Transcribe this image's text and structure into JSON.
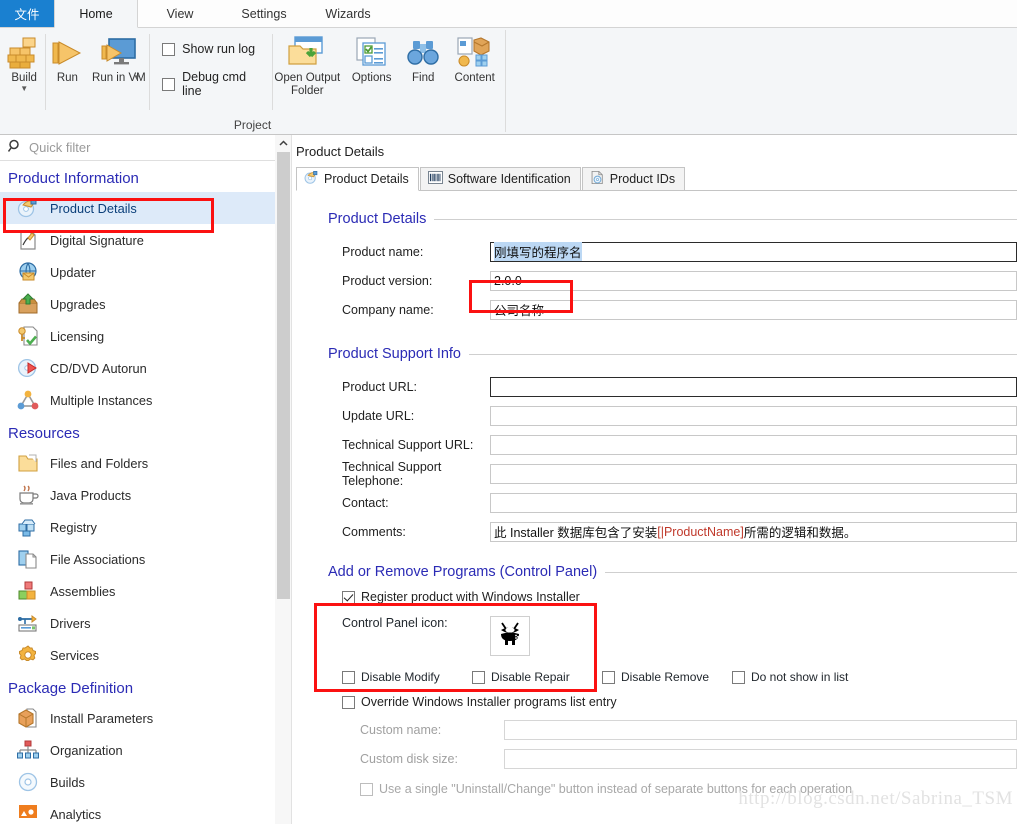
{
  "ribbon": {
    "tabs": [
      {
        "label": "文件",
        "id": "file"
      },
      {
        "label": "Home",
        "id": "home"
      },
      {
        "label": "View",
        "id": "view"
      },
      {
        "label": "Settings",
        "id": "settings"
      },
      {
        "label": "Wizards",
        "id": "wizards"
      }
    ],
    "buttons": {
      "build": "Build",
      "run": "Run",
      "run_in_vm": "Run in VM",
      "open_output_folder": "Open Output Folder",
      "options": "Options",
      "find": "Find",
      "content": "Content"
    },
    "checkboxes": [
      {
        "label": "Show run log",
        "checked": false
      },
      {
        "label": "Debug cmd line",
        "checked": false
      }
    ],
    "group_label": "Project"
  },
  "sidebar": {
    "filter_placeholder": "Quick filter",
    "sections": [
      {
        "title": "Product Information",
        "items": [
          {
            "label": "Product Details",
            "icon": "disc-hand-icon",
            "selected": true
          },
          {
            "label": "Digital Signature",
            "icon": "signature-page-icon",
            "selected": false
          },
          {
            "label": "Updater",
            "icon": "globe-mail-icon",
            "selected": false
          },
          {
            "label": "Upgrades",
            "icon": "box-up-arrow-icon",
            "selected": false
          },
          {
            "label": "Licensing",
            "icon": "key-check-icon",
            "selected": false
          },
          {
            "label": "CD/DVD Autorun",
            "icon": "disc-play-icon",
            "selected": false
          },
          {
            "label": "Multiple Instances",
            "icon": "nodes-icon",
            "selected": false
          }
        ]
      },
      {
        "title": "Resources",
        "items": [
          {
            "label": "Files and Folders",
            "icon": "folder-icon",
            "selected": false
          },
          {
            "label": "Java Products",
            "icon": "coffee-cup-icon",
            "selected": false
          },
          {
            "label": "Registry",
            "icon": "registry-blocks-icon",
            "selected": false
          },
          {
            "label": "File Associations",
            "icon": "file-pages-icon",
            "selected": false
          },
          {
            "label": "Assemblies",
            "icon": "cubes-icon",
            "selected": false
          },
          {
            "label": "Drivers",
            "icon": "usb-icon",
            "selected": false
          },
          {
            "label": "Services",
            "icon": "gear-icon",
            "selected": false
          }
        ]
      },
      {
        "title": "Package Definition",
        "items": [
          {
            "label": "Install Parameters",
            "icon": "open-box-icon",
            "selected": false
          },
          {
            "label": "Organization",
            "icon": "hierarchy-icon",
            "selected": false
          },
          {
            "label": "Builds",
            "icon": "disc-ring-icon",
            "selected": false
          },
          {
            "label": "Analytics",
            "icon": "chart-icon",
            "selected": false
          }
        ]
      }
    ]
  },
  "main": {
    "pane_title": "Product Details",
    "tabs": [
      {
        "label": "Product Details",
        "icon": "disc-hand-icon",
        "active": true
      },
      {
        "label": "Software Identification",
        "icon": "barcode-icon",
        "active": false
      },
      {
        "label": "Product IDs",
        "icon": "id-disc-icon",
        "active": false
      }
    ],
    "product_details": {
      "legend": "Product Details",
      "fields": [
        {
          "label": "Product name:",
          "value": "刚填写的程序名",
          "selected_text": true,
          "focused": true
        },
        {
          "label": "Product version:",
          "value": "2.0.0",
          "selected_text": false,
          "focused": false
        },
        {
          "label": "Company name:",
          "value": "公司名称",
          "selected_text": false,
          "focused": false
        }
      ]
    },
    "product_support": {
      "legend": "Product Support Info",
      "fields": [
        {
          "label": "Product URL:",
          "value": ""
        },
        {
          "label": "Update URL:",
          "value": ""
        },
        {
          "label": "Technical Support URL:",
          "value": ""
        },
        {
          "label": "Technical Support Telephone:",
          "value": ""
        },
        {
          "label": "Contact:",
          "value": ""
        }
      ],
      "comments_label": "Comments:",
      "comments_parts": {
        "prefix": "此 Installer 数据库包含了安装 ",
        "property": "[|ProductName]",
        "suffix": " 所需的逻辑和数据。"
      }
    },
    "arp": {
      "legend": "Add or Remove Programs (Control Panel)",
      "register_label": "Register product with Windows Installer",
      "register_checked": true,
      "icon_label": "Control Panel icon:",
      "icon_name": "beetle-bug-icon",
      "toggles": [
        {
          "label": "Disable Modify",
          "checked": false
        },
        {
          "label": "Disable Repair",
          "checked": false
        },
        {
          "label": "Disable Remove",
          "checked": false
        },
        {
          "label": "Do not show in list",
          "checked": false
        }
      ],
      "override_label": "Override Windows Installer programs list entry",
      "override_checked": false,
      "custom_name_label": "Custom name:",
      "custom_name_value": "",
      "custom_disk_label": "Custom disk size:",
      "custom_disk_value": "",
      "single_button_label": "Use a single \"Uninstall/Change\" button instead of separate buttons for each operation",
      "single_button_checked": false
    }
  },
  "watermark": "http://blog.csdn.net/Sabrina_TSM",
  "colors": {
    "file_tab": "#1a80d0",
    "legend_text": "#2b2bb5",
    "selection": "#bcd8f4",
    "sidebar_selected": "#ddeaf9",
    "highlight_box": "#fb1111",
    "property_token": "#c0392b"
  }
}
